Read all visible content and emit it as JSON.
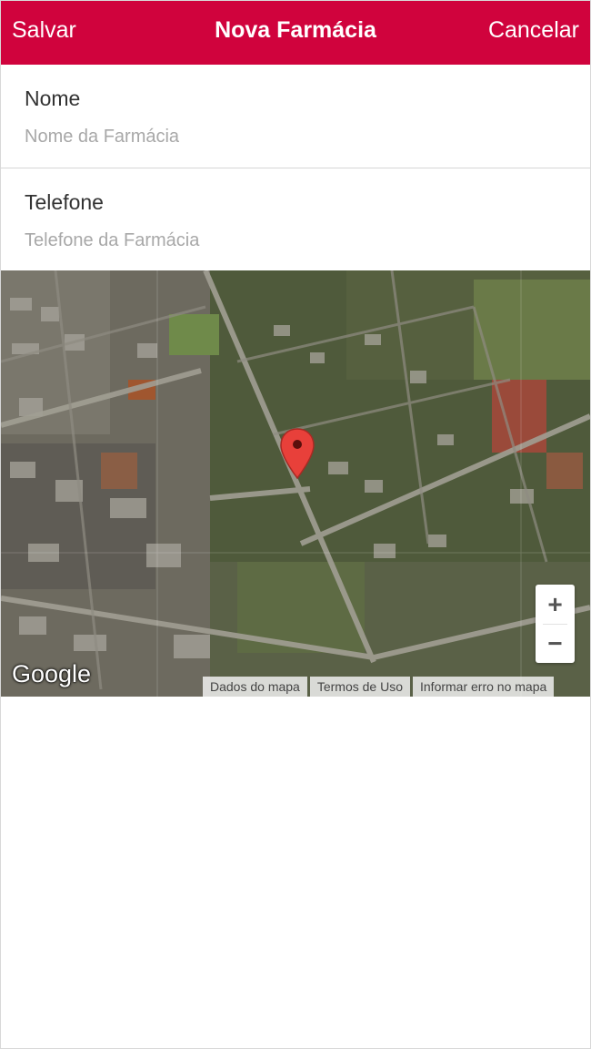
{
  "navbar": {
    "left_label": "Salvar",
    "title": "Nova Farmácia",
    "right_label": "Cancelar",
    "background_color": "#d0033d"
  },
  "form": {
    "name_label": "Nome",
    "name_placeholder": "Nome da Farmácia",
    "name_value": "",
    "phone_label": "Telefone",
    "phone_placeholder": "Telefone da Farmácia",
    "phone_value": ""
  },
  "map": {
    "type": "satellite",
    "marker_icon": "map-pin-icon",
    "marker_color": "#e8403a",
    "zoom_in_label": "+",
    "zoom_out_label": "−",
    "provider_logo": "Google",
    "attribution": [
      "Dados do mapa",
      "Termos de Uso",
      "Informar erro no mapa"
    ]
  }
}
